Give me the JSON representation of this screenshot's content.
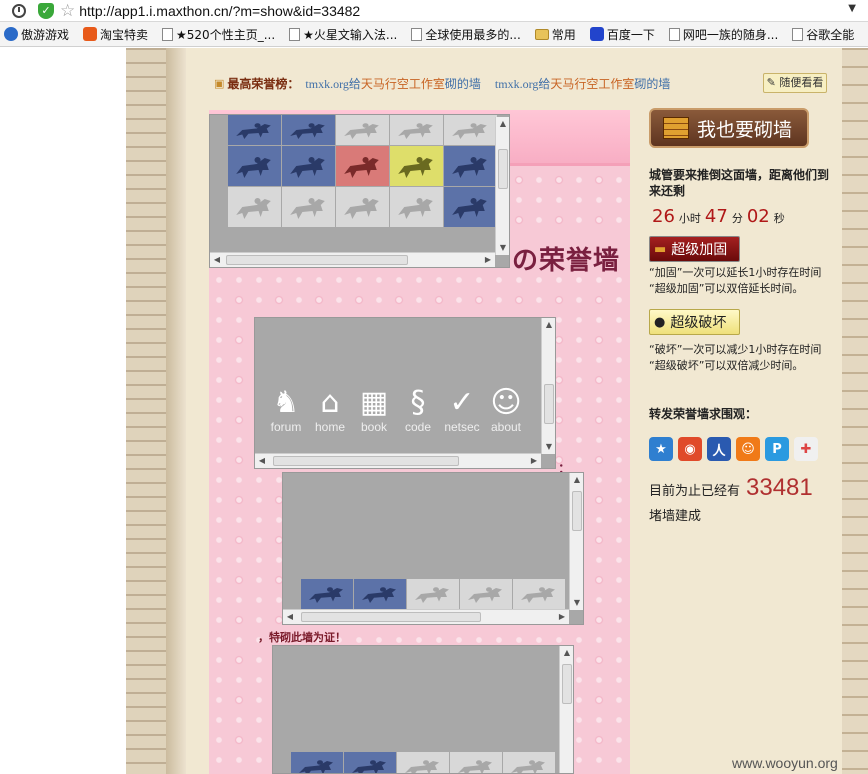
{
  "browser": {
    "url": "http://app1.i.maxthon.cn/?m=show&id=33482",
    "bookmarks": [
      {
        "label": "傲游游戏",
        "icon": "maxthon-icon"
      },
      {
        "label": "淘宝特卖",
        "icon": "taobao-icon"
      },
      {
        "label": "★520个性主页_...",
        "icon": "page-icon"
      },
      {
        "label": "★火星文输入法...",
        "icon": "page-icon"
      },
      {
        "label": "全球使用最多的...",
        "icon": "page-icon"
      },
      {
        "label": "常用",
        "icon": "folder-icon"
      },
      {
        "label": "百度一下",
        "icon": "baidu-icon"
      },
      {
        "label": "网吧一族的随身...",
        "icon": "page-icon"
      },
      {
        "label": "谷歌全能",
        "icon": "page-icon"
      }
    ]
  },
  "honor_bar": {
    "label": "最高荣誉榜：",
    "entries": [
      {
        "a": "tmxk.org",
        "b": "给",
        "c": "天马行空工作室",
        "d": "砌的墙"
      },
      {
        "a": "tmxk.org",
        "b": "给",
        "c": "天马行空工作室",
        "d": "砌的墙"
      }
    ],
    "random_label": "随便看看"
  },
  "wall": {
    "title": "の荣誉墙",
    "witness": "，特砌此墙为证！",
    "colon": "："
  },
  "nav_icons": [
    {
      "label": "forum",
      "icon": "knight-icon",
      "glyph": "♞"
    },
    {
      "label": "home",
      "icon": "house-icon",
      "glyph": "⌂"
    },
    {
      "label": "book",
      "icon": "book-icon",
      "glyph": "▦"
    },
    {
      "label": "code",
      "icon": "code-icon",
      "glyph": "§"
    },
    {
      "label": "netsec",
      "icon": "netsec-icon",
      "glyph": "✓"
    },
    {
      "label": "about",
      "icon": "face-icon",
      "glyph": "☺"
    }
  ],
  "sidebar": {
    "build_button": "我也要砌墙",
    "countdown_head": "城管要来推倒这面墙，距离他们到来还剩",
    "hours": "26",
    "hours_unit": "小时",
    "minutes": "47",
    "minutes_unit": "分",
    "seconds": "02",
    "seconds_unit": "秒",
    "reinforce_button": "超级加固",
    "reinforce_note_1": "“加固”一次可以延长1小时存在时间",
    "reinforce_note_2": "“超级加固”可以双倍延长时间。",
    "destroy_button": "超级破坏",
    "destroy_note_1": "“破坏”一次可以减少1小时存在时间",
    "destroy_note_2": "“超级破坏”可以双倍减少时间。",
    "share_title": "转发荣誉墙求围观：",
    "share_icons": [
      {
        "icon": "qzone-star-icon",
        "color": "#2f7fd0",
        "glyph": "★"
      },
      {
        "icon": "weibo-icon",
        "color": "#e04a2a",
        "glyph": "◉"
      },
      {
        "icon": "renren-icon",
        "color": "#2a5ab0",
        "glyph": "人"
      },
      {
        "icon": "kaixin-icon",
        "color": "#f07a18",
        "glyph": "☺"
      },
      {
        "icon": "pengyou-icon",
        "color": "#2a9ae0",
        "glyph": "P"
      },
      {
        "icon": "share-plus-icon",
        "color": "#f0f0f0",
        "glyph": "✚"
      }
    ],
    "count_prefix": "目前为止已经有",
    "count": "33481",
    "count_suffix": "堵墙建成"
  },
  "watermark": "www.wooyun.org",
  "colors": {
    "pink": "#f7c9d6",
    "accent_red": "#b01818",
    "link_blue": "#3f6fa8"
  }
}
